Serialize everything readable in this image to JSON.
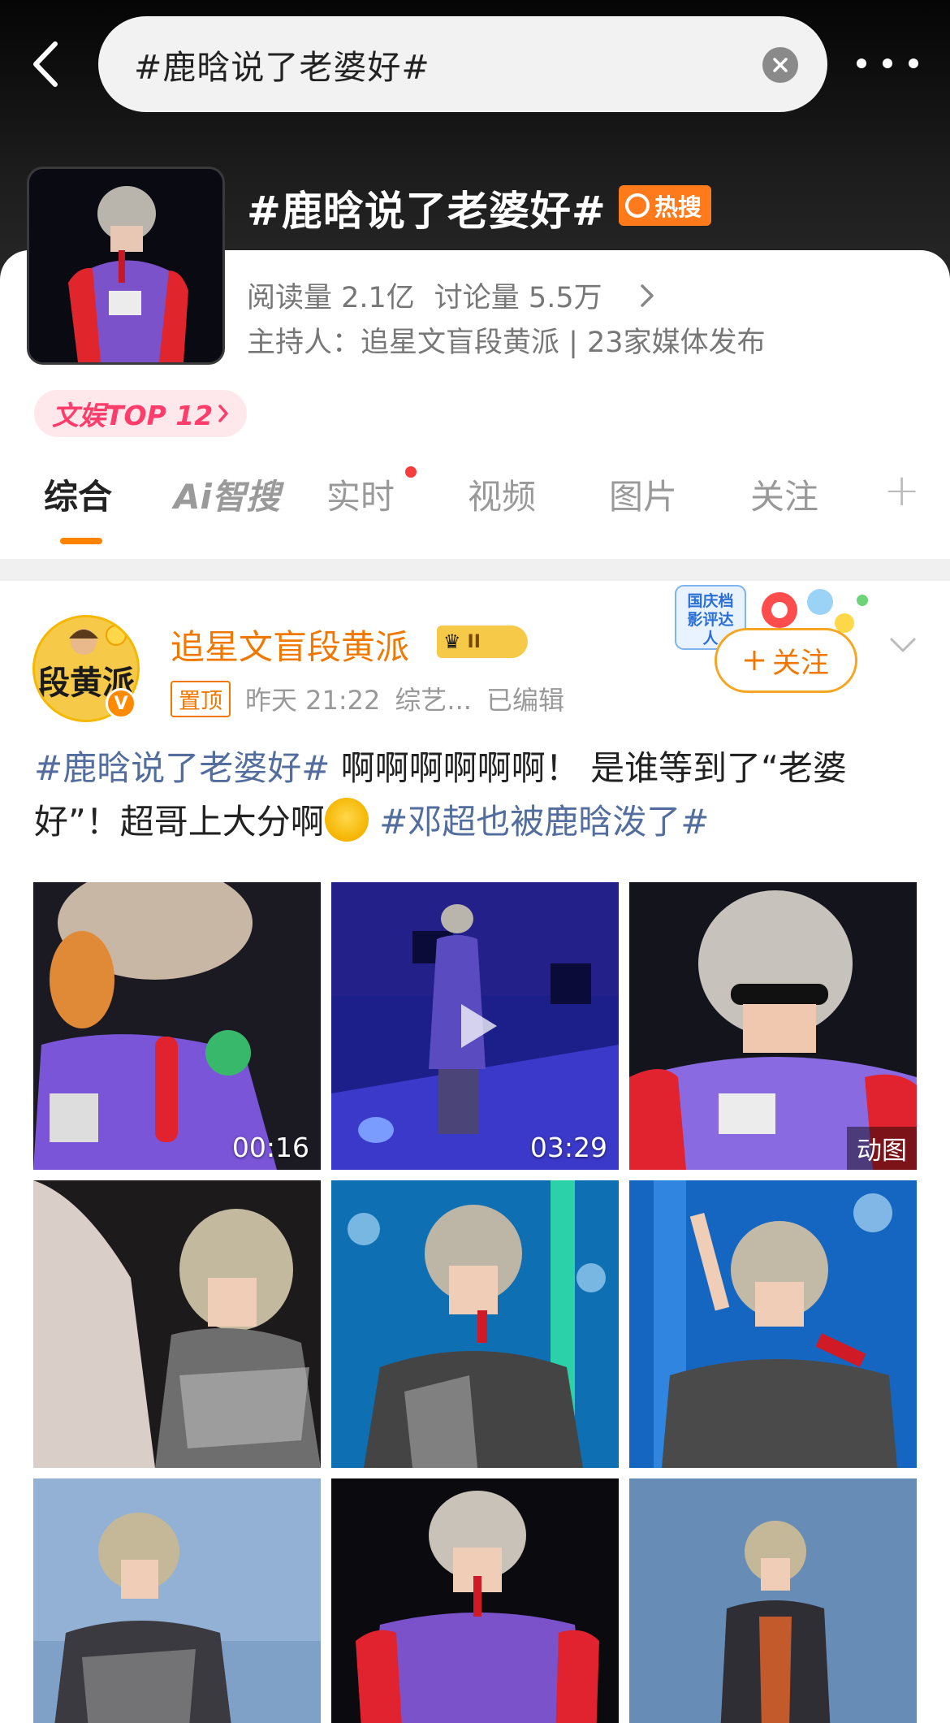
{
  "header": {
    "search_value": "#鹿晗说了老婆好#",
    "topic_title": "#鹿晗说了老婆好#",
    "hot_badge": "热搜"
  },
  "topic": {
    "read_count": "阅读量 2.1亿",
    "discuss_count": "讨论量 5.5万",
    "host_line": "主持人：追星文盲段黄派 | 23家媒体发布",
    "rank_badge": "文娱TOP 12"
  },
  "tabs": [
    {
      "label": "综合",
      "active": true
    },
    {
      "label": "Ai智搜"
    },
    {
      "label": "实时",
      "has_dot": true
    },
    {
      "label": "视频"
    },
    {
      "label": "图片"
    },
    {
      "label": "关注"
    }
  ],
  "post": {
    "avatar_text": "段黄派",
    "verified_mark": "V",
    "author": "追星文盲段黄派",
    "level": "II",
    "pin": "置顶",
    "time": "昨天 21:22",
    "source": "综艺...",
    "edited": "已编辑",
    "holiday_badge": "国庆档影评达人",
    "follow_label": "关注",
    "text": {
      "tag1": "#鹿晗说了老婆好#",
      "body1": " 啊啊啊啊啊啊！ 是谁等到了“老婆好”！超哥上大分啊",
      "tag2": " #邓超也被鹿晗泼了#"
    },
    "media": [
      {
        "type": "video",
        "duration": "00:16"
      },
      {
        "type": "video",
        "duration": "03:29"
      },
      {
        "type": "gif",
        "tag": "动图"
      },
      {
        "type": "image"
      },
      {
        "type": "image"
      },
      {
        "type": "image"
      },
      {
        "type": "image"
      },
      {
        "type": "image"
      },
      {
        "type": "image"
      }
    ]
  },
  "colors": {
    "accent": "#ff8200",
    "hashtag": "#536e9e",
    "author": "#f07800",
    "hot": "#ff7a1a"
  }
}
